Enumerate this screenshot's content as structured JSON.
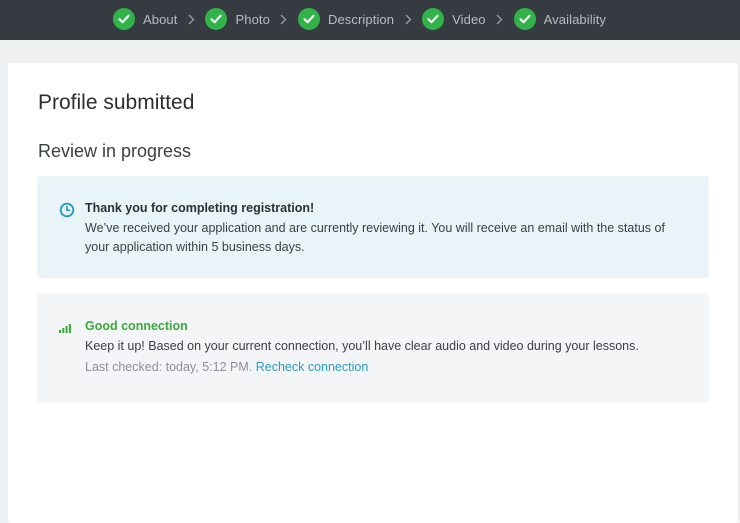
{
  "steps": [
    {
      "label": "About",
      "status": "complete"
    },
    {
      "label": "Photo",
      "status": "complete"
    },
    {
      "label": "Description",
      "status": "complete"
    },
    {
      "label": "Video",
      "status": "complete"
    },
    {
      "label": "Availability",
      "status": "complete"
    }
  ],
  "page": {
    "title": "Profile submitted",
    "subtitle": "Review in progress"
  },
  "review_notice": {
    "icon": "clock-icon",
    "heading": "Thank you for completing registration!",
    "text": "We’ve received your application and are currently reviewing it. You will receive an email with the status of your application within 5 business days."
  },
  "connection": {
    "icon": "signal-bars-icon",
    "heading": "Good connection",
    "text": "Keep it up! Based on your current connection, you’ll have clear audio and video during your lessons.",
    "last_checked": "Last checked: today, 5:12 PM.",
    "recheck_link": "Recheck connection"
  },
  "colors": {
    "topbar": "#353b41",
    "step_check": "#32b34a",
    "info_panel": "#e8f4f8",
    "accent_teal": "#2b9bc4",
    "good_green": "#3aaa3a"
  }
}
